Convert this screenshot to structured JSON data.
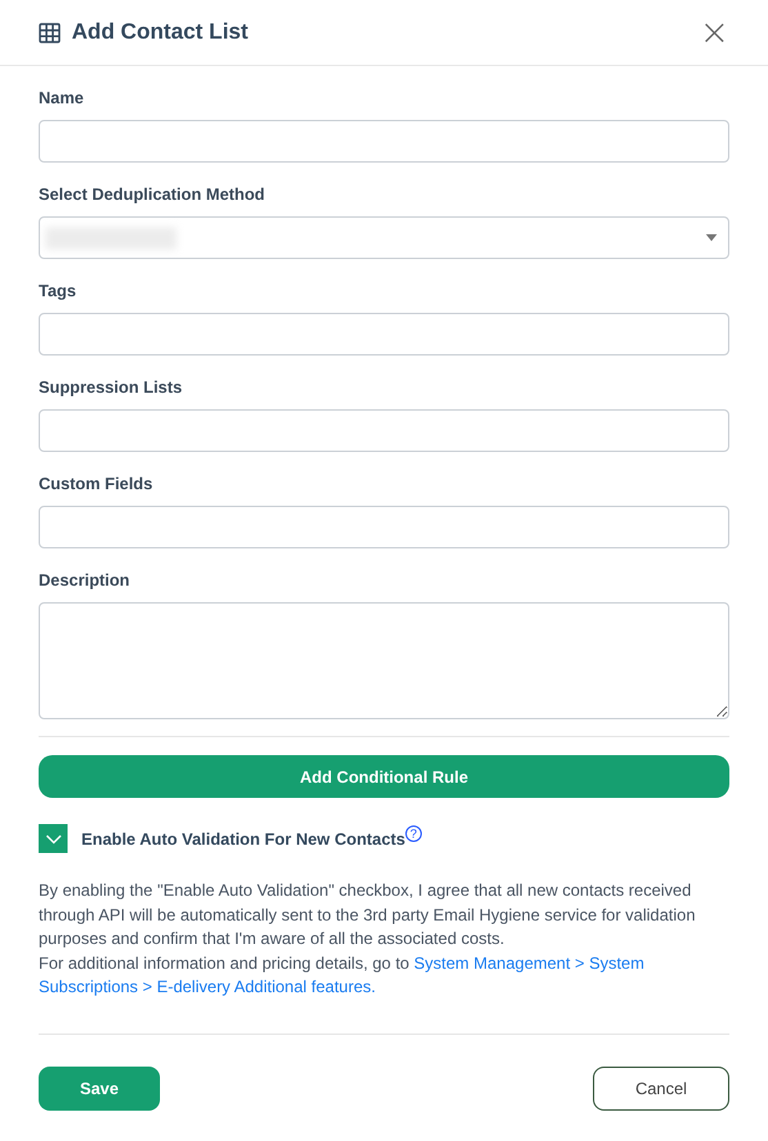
{
  "dialog": {
    "title": "Add Contact List",
    "close": "×"
  },
  "fields": [
    {
      "kind": "text",
      "label": "Name"
    },
    {
      "kind": "select",
      "label": "Select Deduplication Method",
      "value_blurred": true
    },
    {
      "kind": "text",
      "label": "Tags"
    },
    {
      "kind": "text",
      "label": "Suppression Lists"
    },
    {
      "kind": "text",
      "label": "Custom Fields"
    },
    {
      "kind": "textarea",
      "label": "Description"
    }
  ],
  "add_rule_button": "Add Conditional Rule",
  "auto_validation": {
    "label": "Enable Auto Validation For New Contacts",
    "checked": true,
    "help": "?"
  },
  "notice": {
    "text": "By enabling the \"Enable Auto Validation\" checkbox, I agree that all new contacts received through API will be automatically sent to the 3rd party Email Hygiene service for validation purposes and confirm that I'm aware of all the associated costs.",
    "lead": "For additional information and pricing details, go to",
    "link_lines": [
      "System Management > System",
      "Subscriptions > E-delivery Additional features."
    ]
  },
  "buttons": {
    "save": "Save",
    "cancel": "Cancel"
  }
}
